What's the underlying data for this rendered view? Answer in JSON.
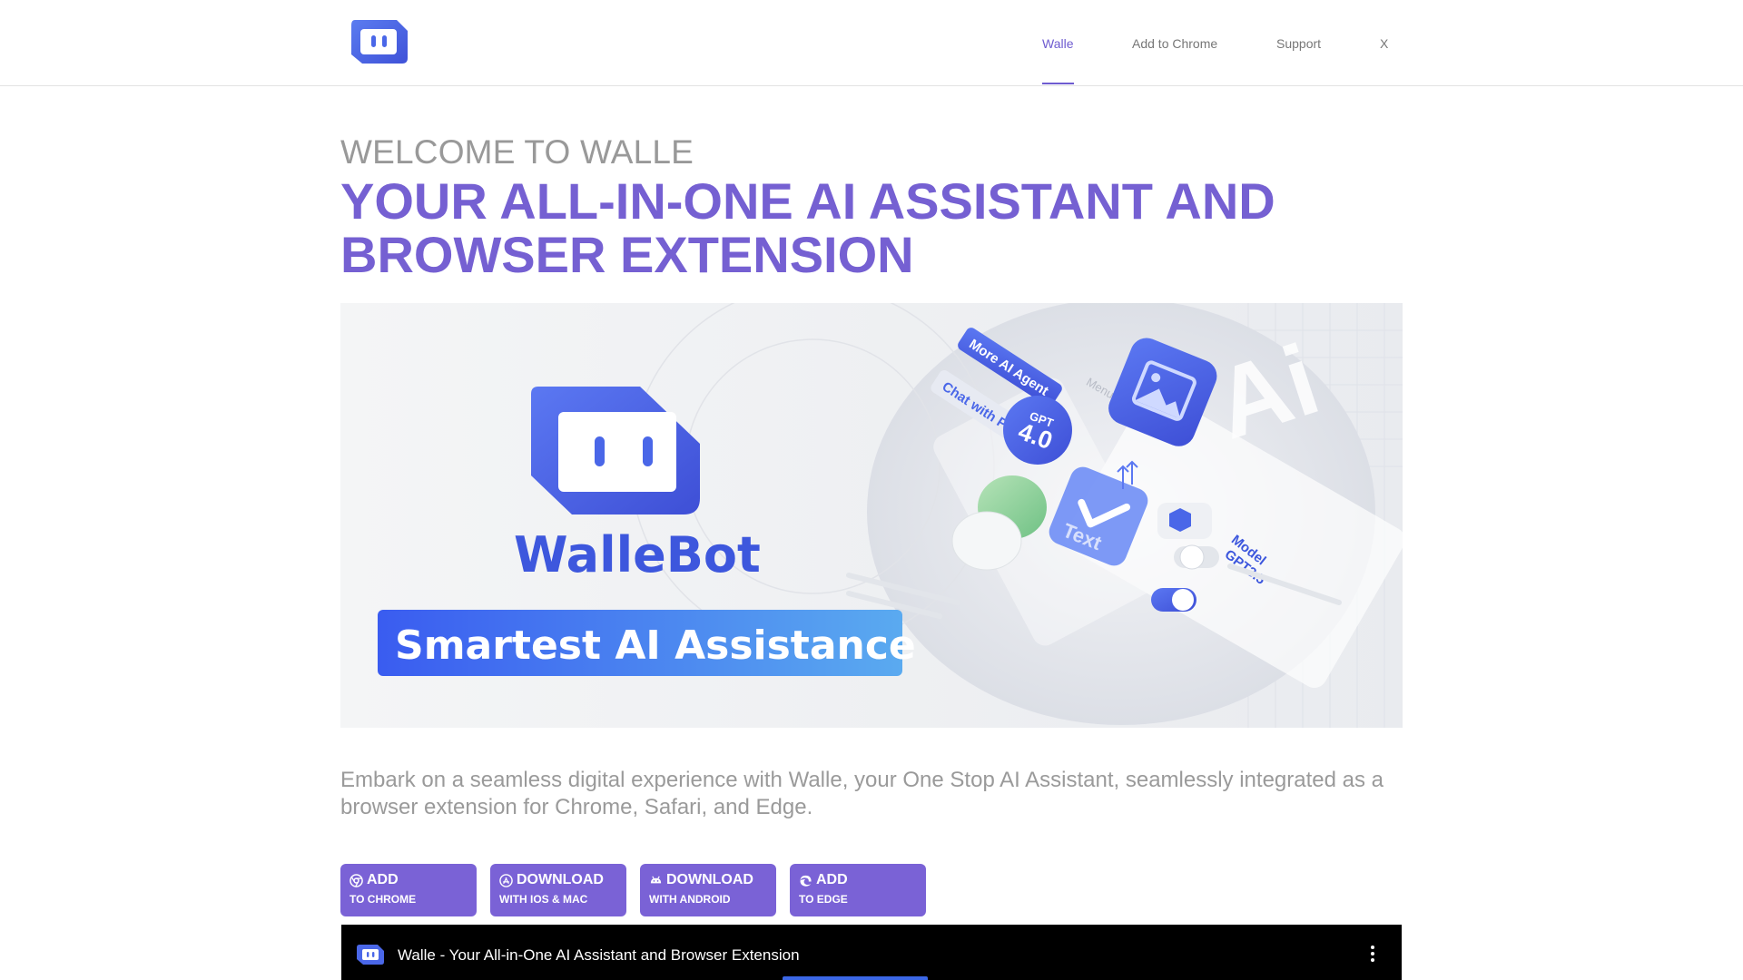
{
  "nav": {
    "items": [
      {
        "label": "Walle",
        "active": true
      },
      {
        "label": "Add to Chrome",
        "active": false
      },
      {
        "label": "Support",
        "active": false
      },
      {
        "label": "X",
        "active": false
      }
    ]
  },
  "hero": {
    "kicker": "WELCOME TO WALLE",
    "title": "YOUR ALL-IN-ONE AI ASSISTANT AND BROWSER EXTENSION"
  },
  "banner": {
    "brand": "WalleBot",
    "tagline": "Smartest AI Assistance",
    "tag_agent": "More AI Agent",
    "tag_pdf": "Chat with PDF",
    "gpt_label": "GPT",
    "gpt_version": "4.0",
    "text_label": "Text",
    "model_label": "Model",
    "model_value": "GPT3.5",
    "menu_label": "Menu",
    "ai_watermark": "Ai"
  },
  "description": "Embark on a seamless digital experience with Walle, your One Stop AI Assistant, seamlessly integrated as a browser extension for Chrome, Safari, and Edge.",
  "buttons": [
    {
      "line1": "ADD",
      "line2": "TO CHROME",
      "icon": "chrome-icon"
    },
    {
      "line1": "DOWNLOAD",
      "line2": "WITH IOS & MAC",
      "icon": "app-store-icon"
    },
    {
      "line1": "DOWNLOAD",
      "line2": "WITH ANDROID",
      "icon": "android-icon"
    },
    {
      "line1": "ADD",
      "line2": "TO EDGE",
      "icon": "edge-icon"
    }
  ],
  "video": {
    "title": "Walle - Your All-in-One AI Assistant and Browser Extension"
  },
  "colors": {
    "accent": "#7560d2",
    "button": "#7a62d6",
    "brand_blue": "#4a67e8"
  }
}
